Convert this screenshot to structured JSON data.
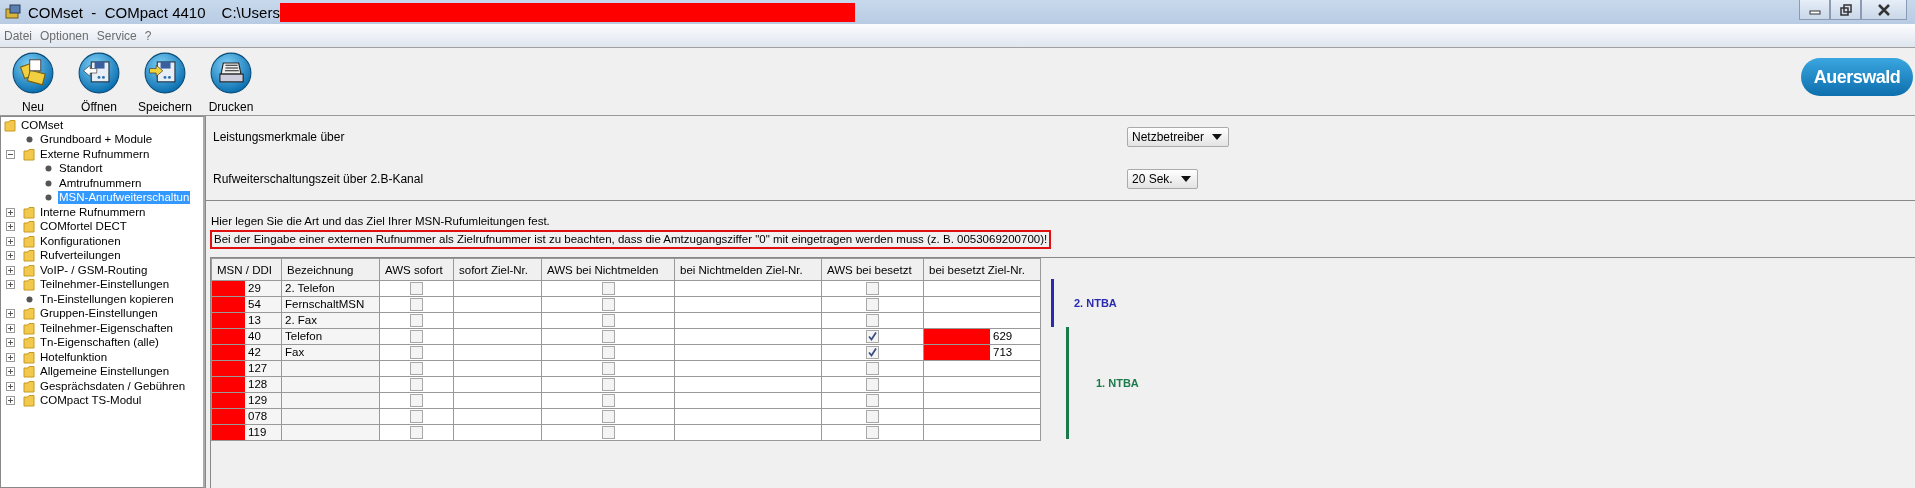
{
  "window": {
    "title": "COMset  -  COMpact 4410",
    "path": "C:\\Users",
    "path_redacted": true
  },
  "menu": [
    "Datei",
    "Optionen",
    "Service",
    "?"
  ],
  "toolbar": [
    {
      "label": "Neu",
      "kind": "new"
    },
    {
      "label": "Öffnen",
      "kind": "open"
    },
    {
      "label": "Speichern",
      "kind": "save"
    },
    {
      "label": "Drucken",
      "kind": "print"
    }
  ],
  "logo": "Auerswald",
  "tree": {
    "label": "COMset",
    "kind": "folder",
    "selected": false,
    "children": [
      {
        "label": "Grundboard + Module",
        "kind": "leaf",
        "selected": false
      },
      {
        "label": "Externe Rufnummern",
        "kind": "folder",
        "expanded": true,
        "selected": false,
        "children": [
          {
            "label": "Standort",
            "kind": "leaf",
            "selected": false
          },
          {
            "label": "Amtrufnummern",
            "kind": "leaf",
            "selected": false
          },
          {
            "label": "MSN-Anrufweiterschaltun",
            "kind": "leaf",
            "selected": true
          }
        ]
      },
      {
        "label": "Interne Rufnummern",
        "kind": "folder",
        "expanded": false,
        "selected": false
      },
      {
        "label": "COMfortel DECT",
        "kind": "folder",
        "expanded": false,
        "selected": false
      },
      {
        "label": "Konfigurationen",
        "kind": "folder",
        "expanded": false,
        "selected": false
      },
      {
        "label": "Rufverteilungen",
        "kind": "folder",
        "expanded": false,
        "selected": false
      },
      {
        "label": "VoIP- / GSM-Routing",
        "kind": "folder",
        "expanded": false,
        "selected": false
      },
      {
        "label": "Teilnehmer-Einstellungen",
        "kind": "folder",
        "expanded": false,
        "selected": false
      },
      {
        "label": "Tn-Einstellungen kopieren",
        "kind": "leaf",
        "selected": false
      },
      {
        "label": "Gruppen-Einstellungen",
        "kind": "folder",
        "expanded": false,
        "selected": false
      },
      {
        "label": "Teilnehmer-Eigenschaften",
        "kind": "folder",
        "expanded": false,
        "selected": false
      },
      {
        "label": "Tn-Eigenschaften (alle)",
        "kind": "folder",
        "expanded": false,
        "selected": false
      },
      {
        "label": "Hotelfunktion",
        "kind": "folder",
        "expanded": false,
        "selected": false
      },
      {
        "label": "Allgemeine Einstellungen",
        "kind": "folder",
        "expanded": false,
        "selected": false
      },
      {
        "label": "Gesprächsdaten / Gebühren",
        "kind": "folder",
        "expanded": false,
        "selected": false
      },
      {
        "label": "COMpact TS-Modul",
        "kind": "folder",
        "expanded": false,
        "selected": false
      }
    ]
  },
  "settings": [
    {
      "label": "Leistungsmerkmale über",
      "value": "Netzbetreiber"
    },
    {
      "label": "Rufweiterschaltungszeit über 2.B-Kanal",
      "value": "20 Sek."
    }
  ],
  "info": "Hier legen Sie die Art und das Ziel Ihrer MSN-Rufumleitungen fest.",
  "notice": "Bei der Eingabe einer externen Rufnummer als Zielrufnummer ist zu beachten, dass die Amtzugangsziffer \"0\" mit eingetragen werden muss (z. B. 0053069200700)!",
  "table": {
    "columns": [
      "MSN / DDI",
      "Bezeichnung",
      "AWS sofort",
      "sofort Ziel-Nr.",
      "AWS bei Nichtmelden",
      "bei Nichtmelden Ziel-Nr.",
      "AWS bei besetzt",
      "bei besetzt Ziel-Nr."
    ],
    "rows": [
      {
        "msn": "29",
        "msn_redacted": true,
        "bezeichnung": "2. Telefon",
        "aws_sofort": false,
        "aws_nichtmelden": false,
        "aws_besetzt": false
      },
      {
        "msn": "54",
        "msn_redacted": true,
        "bezeichnung": "FernschaltMSN",
        "aws_sofort": false,
        "aws_nichtmelden": false,
        "aws_besetzt": false
      },
      {
        "msn": "13",
        "msn_redacted": true,
        "bezeichnung": "2. Fax",
        "aws_sofort": false,
        "aws_nichtmelden": false,
        "aws_besetzt": false
      },
      {
        "msn": "40",
        "msn_redacted": true,
        "bezeichnung": "Telefon",
        "aws_sofort": false,
        "aws_nichtmelden": false,
        "aws_besetzt": true,
        "besetzt_ziel": "629",
        "besetzt_ziel_redacted": true
      },
      {
        "msn": "42",
        "msn_redacted": true,
        "bezeichnung": "Fax",
        "aws_sofort": false,
        "aws_nichtmelden": false,
        "aws_besetzt": true,
        "besetzt_ziel": "713",
        "besetzt_ziel_redacted": true
      },
      {
        "msn": "127",
        "msn_redacted": true,
        "aws_sofort": false,
        "aws_nichtmelden": false,
        "aws_besetzt": false
      },
      {
        "msn": "128",
        "msn_redacted": true,
        "aws_sofort": false,
        "aws_nichtmelden": false,
        "aws_besetzt": false
      },
      {
        "msn": "129",
        "msn_redacted": true,
        "aws_sofort": false,
        "aws_nichtmelden": false,
        "aws_besetzt": false
      },
      {
        "msn": "078",
        "msn_redacted": true,
        "aws_sofort": false,
        "aws_nichtmelden": false,
        "aws_besetzt": false
      },
      {
        "msn": "119",
        "msn_redacted": true,
        "aws_sofort": false,
        "aws_nichtmelden": false,
        "aws_besetzt": false
      }
    ]
  },
  "annotations": [
    {
      "label": "2. NTBA",
      "color": "#2a2ab0"
    },
    {
      "label": "1. NTBA",
      "color": "#1b7a4a"
    }
  ]
}
